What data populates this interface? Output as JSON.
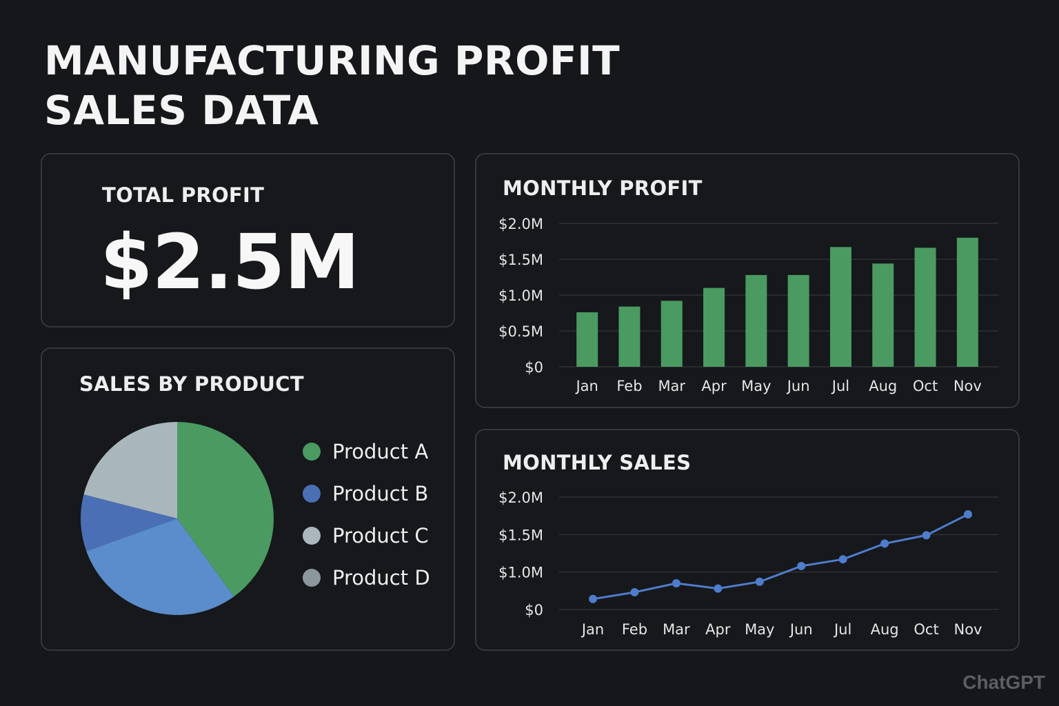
{
  "title": {
    "line1": "MANUFACTURING PROFIT",
    "line2": "SALES DATA"
  },
  "total_profit": {
    "label": "TOTAL PROFIT",
    "value": "$2.5M"
  },
  "sales_by_product": {
    "label": "SALES BY PRODUCT",
    "items": [
      {
        "name": "Product A",
        "color": "#4a9a62"
      },
      {
        "name": "Product B",
        "color": "#4a6fb5"
      },
      {
        "name": "Product C",
        "color": "#a9b6bb"
      },
      {
        "name": "Product D",
        "color": "#8c979d"
      }
    ]
  },
  "monthly_profit": {
    "label": "MONTHLY PROFIT"
  },
  "monthly_sales": {
    "label": "MONTHLY SALES"
  },
  "watermark": "ChatGPT",
  "colors": {
    "background": "#15171a",
    "card_border": "#34373c",
    "bar_green": "#4a9a62",
    "line_blue": "#4f7ccc",
    "grid": "#3a3d42",
    "pie_blue_light": "#5b8ccb"
  },
  "chart_data": [
    {
      "type": "pie",
      "title": "SALES BY PRODUCT",
      "categories": [
        "Product A",
        "Product B (light blue)",
        "Product B",
        "Product C"
      ],
      "values": [
        40,
        29.5,
        9.5,
        21
      ],
      "colors": [
        "#4a9a62",
        "#5b8ccb",
        "#4a6fb5",
        "#a9b6bb"
      ],
      "legend": "right"
    },
    {
      "type": "bar",
      "title": "MONTHLY PROFIT",
      "categories": [
        "Jan",
        "Feb",
        "Mar",
        "Apr",
        "May",
        "Jun",
        "Jul",
        "Aug",
        "Oct",
        "Nov"
      ],
      "values": [
        0.76,
        0.84,
        0.92,
        1.1,
        1.28,
        1.28,
        1.67,
        1.44,
        1.66,
        1.8
      ],
      "yticks": [
        "$0",
        "$0.5M",
        "$1.0M",
        "$1.5M",
        "$2.0M"
      ],
      "ylim": [
        0,
        2.0
      ],
      "grid": true,
      "color": "#4a9a62"
    },
    {
      "type": "line",
      "title": "MONTHLY SALES",
      "categories": [
        "Jan",
        "Feb",
        "Mar",
        "Apr",
        "May",
        "Jun",
        "Jul",
        "Aug",
        "Oct",
        "Nov"
      ],
      "values": [
        0.14,
        0.23,
        0.35,
        0.28,
        0.37,
        0.58,
        0.67,
        0.88,
        0.99,
        1.27
      ],
      "yticks": [
        "$0",
        "$1.0M",
        "$1.5M",
        "$2.0M"
      ],
      "ytick_values": [
        0,
        0.5,
        1.0,
        1.5
      ],
      "ylim": [
        0,
        1.5
      ],
      "grid": true,
      "color": "#4f7ccc"
    }
  ]
}
